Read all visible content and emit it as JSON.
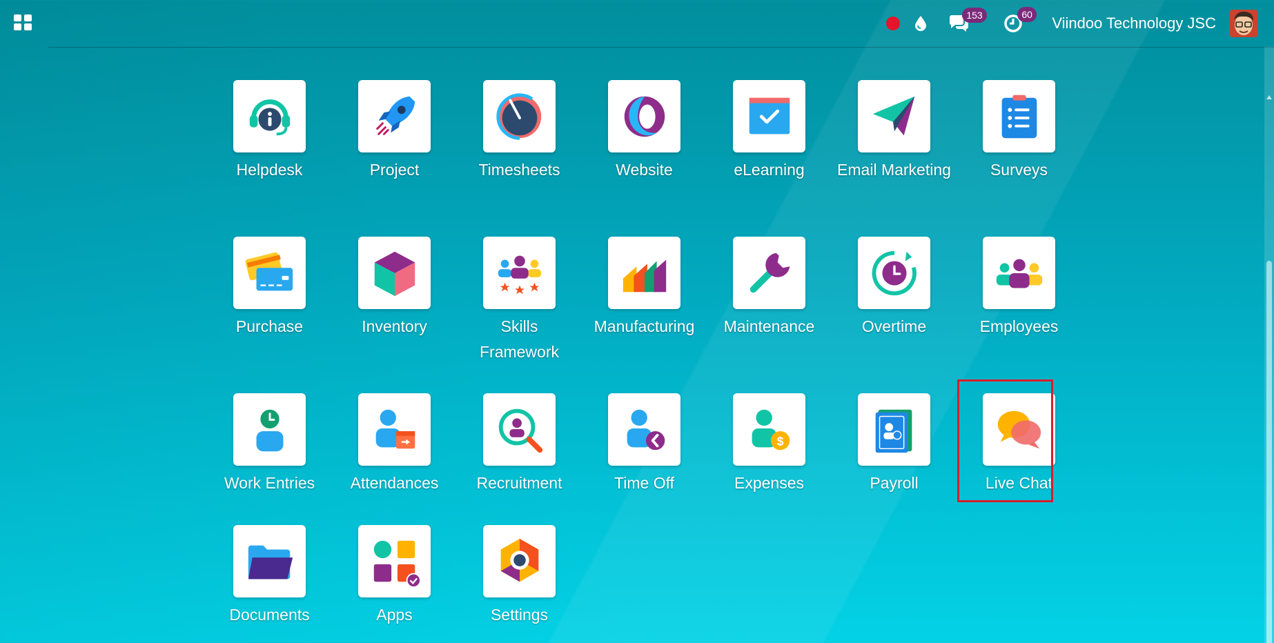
{
  "topbar": {
    "company": "Viindoo Technology JSC",
    "messages_count": "153",
    "activities_count": "60",
    "record_color": "#e5142a",
    "badge_color": "#7a2a79"
  },
  "apps": [
    {
      "id": "helpdesk",
      "label": "Helpdesk",
      "icon": "helpdesk-icon"
    },
    {
      "id": "project",
      "label": "Project",
      "icon": "rocket-icon"
    },
    {
      "id": "timesheets",
      "label": "Timesheets",
      "icon": "gauge-icon"
    },
    {
      "id": "website",
      "label": "Website",
      "icon": "globe-icon"
    },
    {
      "id": "elearning",
      "label": "eLearning",
      "icon": "checkbox-calendar-icon"
    },
    {
      "id": "email-marketing",
      "label": "Email Marketing",
      "icon": "paper-plane-icon"
    },
    {
      "id": "surveys",
      "label": "Surveys",
      "icon": "clipboard-list-icon"
    },
    {
      "id": "purchase",
      "label": "Purchase",
      "icon": "credit-cards-icon"
    },
    {
      "id": "inventory",
      "label": "Inventory",
      "icon": "cube-icon"
    },
    {
      "id": "skills-framework",
      "label": "Skills Framework",
      "icon": "team-stars-icon"
    },
    {
      "id": "manufacturing",
      "label": "Manufacturing",
      "icon": "factory-icon"
    },
    {
      "id": "maintenance",
      "label": "Maintenance",
      "icon": "wrench-icon"
    },
    {
      "id": "overtime",
      "label": "Overtime",
      "icon": "clock-cycle-icon"
    },
    {
      "id": "employees",
      "label": "Employees",
      "icon": "people-group-icon"
    },
    {
      "id": "work-entries",
      "label": "Work Entries",
      "icon": "person-clock-icon"
    },
    {
      "id": "attendances",
      "label": "Attendances",
      "icon": "person-calendar-icon"
    },
    {
      "id": "recruitment",
      "label": "Recruitment",
      "icon": "magnifier-person-icon"
    },
    {
      "id": "time-off",
      "label": "Time Off",
      "icon": "person-back-icon"
    },
    {
      "id": "expenses",
      "label": "Expenses",
      "icon": "person-dollar-icon"
    },
    {
      "id": "payroll",
      "label": "Payroll",
      "icon": "payroll-book-icon"
    },
    {
      "id": "live-chat",
      "label": "Live Chat",
      "icon": "chat-bubbles-icon"
    },
    {
      "id": "documents",
      "label": "Documents",
      "icon": "folder-icon"
    },
    {
      "id": "apps",
      "label": "Apps",
      "icon": "apps-blocks-icon"
    },
    {
      "id": "settings",
      "label": "Settings",
      "icon": "hexagon-gear-icon"
    }
  ]
}
